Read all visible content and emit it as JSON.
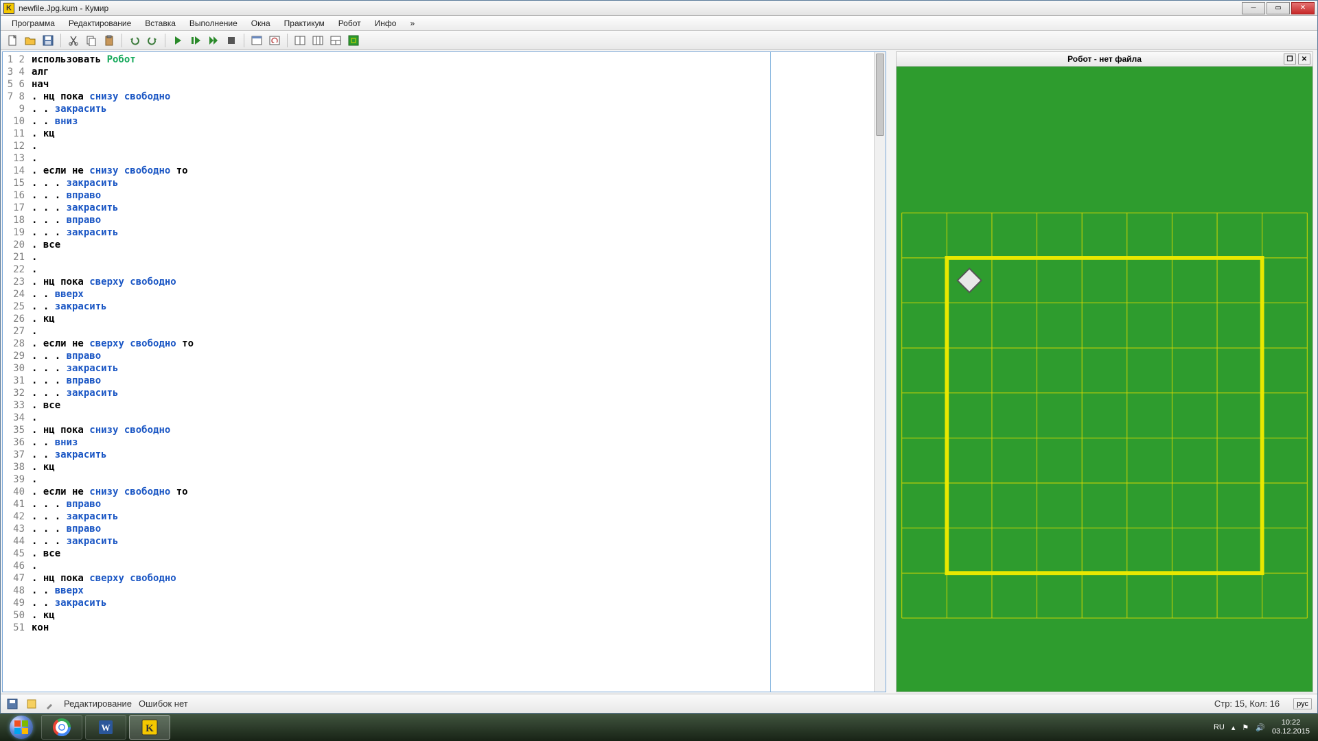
{
  "window": {
    "title": "newfile.Jpg.kum - Кумир",
    "app_letter": "K"
  },
  "menu": [
    "Программа",
    "Редактирование",
    "Вставка",
    "Выполнение",
    "Окна",
    "Практикум",
    "Робот",
    "Инфо",
    "»"
  ],
  "toolbar_icons": [
    "new-file",
    "open-file",
    "save-file",
    "sep",
    "cut",
    "copy",
    "paste",
    "sep",
    "undo",
    "redo",
    "sep",
    "run",
    "step",
    "run-fast",
    "stop",
    "sep",
    "actor-window",
    "actor-reset",
    "sep",
    "layout-1",
    "layout-2",
    "layout-3",
    "robot-env"
  ],
  "code_lines": [
    [
      {
        "t": "использовать ",
        "c": "kw2"
      },
      {
        "t": "Робот",
        "c": "robot"
      }
    ],
    [
      {
        "t": "алг",
        "c": "kw2"
      }
    ],
    [
      {
        "t": "нач",
        "c": "kw2"
      }
    ],
    [
      {
        "t": ". нц пока ",
        "c": "kw2"
      },
      {
        "t": "снизу свободно",
        "c": "kw"
      }
    ],
    [
      {
        "t": ". . ",
        "c": "kw2"
      },
      {
        "t": "закрасить",
        "c": "kw"
      }
    ],
    [
      {
        "t": ". . ",
        "c": "kw2"
      },
      {
        "t": "вниз",
        "c": "kw"
      }
    ],
    [
      {
        "t": ". кц",
        "c": "kw2"
      }
    ],
    [
      {
        "t": ".",
        "c": "kw2"
      }
    ],
    [
      {
        "t": ".",
        "c": "kw2"
      }
    ],
    [
      {
        "t": ". если не ",
        "c": "kw2"
      },
      {
        "t": "снизу свободно",
        "c": "kw"
      },
      {
        "t": " то",
        "c": "kw2"
      }
    ],
    [
      {
        "t": ". . . ",
        "c": "kw2"
      },
      {
        "t": "закрасить",
        "c": "kw"
      }
    ],
    [
      {
        "t": ". . . ",
        "c": "kw2"
      },
      {
        "t": "вправо",
        "c": "kw"
      }
    ],
    [
      {
        "t": ". . . ",
        "c": "kw2"
      },
      {
        "t": "закрасить",
        "c": "kw"
      }
    ],
    [
      {
        "t": ". . . ",
        "c": "kw2"
      },
      {
        "t": "вправо",
        "c": "kw"
      }
    ],
    [
      {
        "t": ". . . ",
        "c": "kw2"
      },
      {
        "t": "закрасить",
        "c": "kw"
      }
    ],
    [
      {
        "t": ". все",
        "c": "kw2"
      }
    ],
    [
      {
        "t": ".",
        "c": "kw2"
      }
    ],
    [
      {
        "t": ".",
        "c": "kw2"
      }
    ],
    [
      {
        "t": ". нц пока ",
        "c": "kw2"
      },
      {
        "t": "сверху свободно",
        "c": "kw"
      }
    ],
    [
      {
        "t": ". . ",
        "c": "kw2"
      },
      {
        "t": "вверх",
        "c": "kw"
      }
    ],
    [
      {
        "t": ". . ",
        "c": "kw2"
      },
      {
        "t": "закрасить",
        "c": "kw"
      }
    ],
    [
      {
        "t": ". кц",
        "c": "kw2"
      }
    ],
    [
      {
        "t": ".",
        "c": "kw2"
      }
    ],
    [
      {
        "t": ". если не ",
        "c": "kw2"
      },
      {
        "t": "сверху свободно",
        "c": "kw"
      },
      {
        "t": " то",
        "c": "kw2"
      }
    ],
    [
      {
        "t": ". . . ",
        "c": "kw2"
      },
      {
        "t": "вправо",
        "c": "kw"
      }
    ],
    [
      {
        "t": ". . . ",
        "c": "kw2"
      },
      {
        "t": "закрасить",
        "c": "kw"
      }
    ],
    [
      {
        "t": ". . . ",
        "c": "kw2"
      },
      {
        "t": "вправо",
        "c": "kw"
      }
    ],
    [
      {
        "t": ". . . ",
        "c": "kw2"
      },
      {
        "t": "закрасить",
        "c": "kw"
      }
    ],
    [
      {
        "t": ". все",
        "c": "kw2"
      }
    ],
    [
      {
        "t": ".",
        "c": "kw2"
      }
    ],
    [
      {
        "t": ". нц пока ",
        "c": "kw2"
      },
      {
        "t": "снизу свободно",
        "c": "kw"
      }
    ],
    [
      {
        "t": ". . ",
        "c": "kw2"
      },
      {
        "t": "вниз",
        "c": "kw"
      }
    ],
    [
      {
        "t": ". . ",
        "c": "kw2"
      },
      {
        "t": "закрасить",
        "c": "kw"
      }
    ],
    [
      {
        "t": ". кц",
        "c": "kw2"
      }
    ],
    [
      {
        "t": ".",
        "c": "kw2"
      }
    ],
    [
      {
        "t": ". если не ",
        "c": "kw2"
      },
      {
        "t": "снизу свободно",
        "c": "kw"
      },
      {
        "t": " то",
        "c": "kw2"
      }
    ],
    [
      {
        "t": ". . . ",
        "c": "kw2"
      },
      {
        "t": "вправо",
        "c": "kw"
      }
    ],
    [
      {
        "t": ". . . ",
        "c": "kw2"
      },
      {
        "t": "закрасить",
        "c": "kw"
      }
    ],
    [
      {
        "t": ". . . ",
        "c": "kw2"
      },
      {
        "t": "вправо",
        "c": "kw"
      }
    ],
    [
      {
        "t": ". . . ",
        "c": "kw2"
      },
      {
        "t": "закрасить",
        "c": "kw"
      }
    ],
    [
      {
        "t": ". все",
        "c": "kw2"
      }
    ],
    [
      {
        "t": ".",
        "c": "kw2"
      }
    ],
    [
      {
        "t": ". нц пока ",
        "c": "kw2"
      },
      {
        "t": "сверху свободно",
        "c": "kw"
      }
    ],
    [
      {
        "t": ". . ",
        "c": "kw2"
      },
      {
        "t": "вверх",
        "c": "kw"
      }
    ],
    [
      {
        "t": ". . ",
        "c": "kw2"
      },
      {
        "t": "закрасить",
        "c": "kw"
      }
    ],
    [
      {
        "t": ". кц",
        "c": "kw2"
      }
    ],
    [
      {
        "t": "кон",
        "c": "kw2"
      }
    ],
    [],
    [],
    [],
    []
  ],
  "robot_panel": {
    "title": "Робот - нет файла",
    "grid": {
      "cols": 9,
      "rows": 9,
      "cell": 68,
      "wall_box": {
        "c0": 1,
        "r0": 1,
        "c1": 8,
        "r1": 8
      },
      "robot_cell": {
        "c": 1,
        "r": 1
      }
    }
  },
  "status": {
    "mode": "Редактирование",
    "errors": "Ошибок нет",
    "cursor": "Стр: 15, Кол: 16",
    "lang_badge": "рус"
  },
  "tray": {
    "lang": "RU",
    "time": "10:22",
    "date": "03.12.2015"
  }
}
